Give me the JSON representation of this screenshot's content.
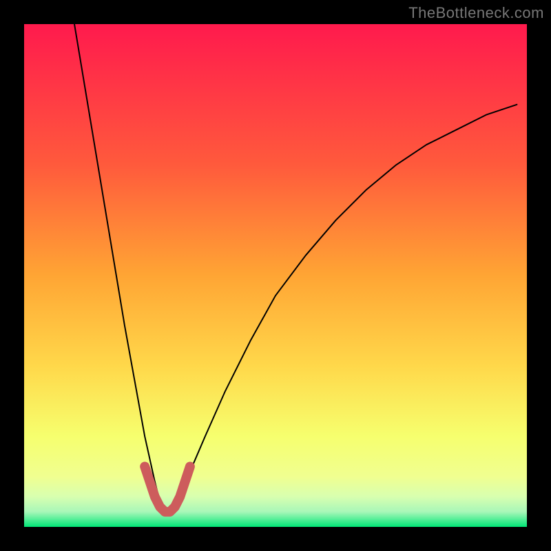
{
  "watermark": "TheBottleneck.com",
  "chart_data": {
    "type": "line",
    "title": "",
    "xlabel": "",
    "ylabel": "",
    "xlim": [
      0,
      100
    ],
    "ylim": [
      0,
      100
    ],
    "grid": false,
    "legend": false,
    "background_gradient": {
      "top": "#ff1a4d",
      "mid1": "#ff7a3a",
      "mid2": "#ffd84a",
      "lower": "#f6ff6e",
      "bottom_band": "#e8ffb0",
      "base": "#00e676"
    },
    "series": [
      {
        "name": "main-curve",
        "x": [
          10,
          12,
          14,
          16,
          18,
          20,
          22,
          24,
          26,
          27,
          28,
          29,
          30,
          31,
          33,
          36,
          40,
          45,
          50,
          56,
          62,
          68,
          74,
          80,
          86,
          92,
          98
        ],
        "y": [
          100,
          88,
          76,
          64,
          52,
          40,
          29,
          18,
          9,
          5,
          3,
          3,
          4,
          6,
          11,
          18,
          27,
          37,
          46,
          54,
          61,
          67,
          72,
          76,
          79,
          82,
          84
        ],
        "stroke": "#000000"
      },
      {
        "name": "bottom-highlight",
        "x": [
          24,
          25,
          26,
          27,
          28,
          29,
          30,
          31,
          32,
          33
        ],
        "y": [
          12,
          9,
          6,
          4,
          3,
          3,
          4,
          6,
          9,
          12
        ],
        "stroke": "#cd5c5c",
        "stroke_width": 14
      }
    ]
  }
}
